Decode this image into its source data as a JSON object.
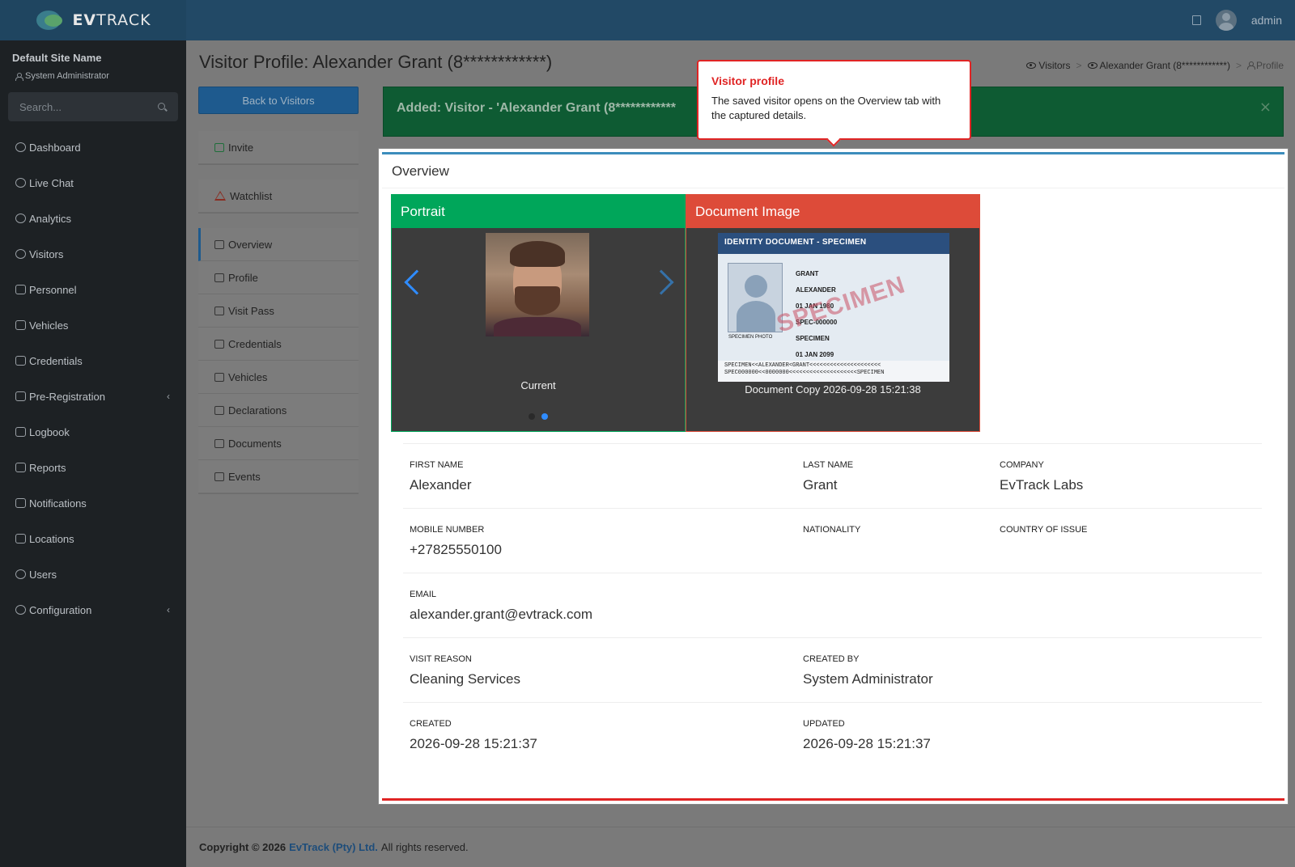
{
  "brand": {
    "logo_text_bold": "EV",
    "logo_text_rest": "TRACK"
  },
  "topbar": {
    "user": "admin"
  },
  "sidebar": {
    "site_name": "Default Site Name",
    "role": "System Administrator",
    "search_placeholder": "Search...",
    "items": [
      {
        "label": "Dashboard",
        "icon": "dashboard-icon"
      },
      {
        "label": "Live Chat",
        "icon": "headset-icon"
      },
      {
        "label": "Analytics",
        "icon": "target-icon"
      },
      {
        "label": "Visitors",
        "icon": "eye-icon"
      },
      {
        "label": "Personnel",
        "icon": "user-cog-icon"
      },
      {
        "label": "Vehicles",
        "icon": "car-icon"
      },
      {
        "label": "Credentials",
        "icon": "id-card-icon"
      },
      {
        "label": "Pre-Registration",
        "icon": "exchange-icon",
        "chevron": "‹"
      },
      {
        "label": "Logbook",
        "icon": "book-icon"
      },
      {
        "label": "Reports",
        "icon": "chart-icon"
      },
      {
        "label": "Notifications",
        "icon": "chat-icon"
      },
      {
        "label": "Locations",
        "icon": "building-icon"
      },
      {
        "label": "Users",
        "icon": "users-icon"
      },
      {
        "label": "Configuration",
        "icon": "gear-icon",
        "chevron": "‹"
      }
    ]
  },
  "page": {
    "title": "Visitor Profile: Alexander Grant (8************)",
    "breadcrumb": [
      "Visitors",
      "Alexander Grant (8************)",
      "Profile"
    ],
    "back_button": "Back to Visitors",
    "actions": [
      "Invite",
      "Watchlist"
    ],
    "tabs": [
      "Overview",
      "Profile",
      "Visit Pass",
      "Credentials",
      "Vehicles",
      "Declarations",
      "Documents",
      "Events"
    ],
    "active_tab": "Overview",
    "alert": "Added: Visitor - 'Alexander Grant (8************",
    "alert_close": "×"
  },
  "tooltip": {
    "title": "Visitor profile",
    "body": "The saved visitor opens on the Overview tab with the captured details."
  },
  "overview": {
    "heading": "Overview",
    "portrait": {
      "title": "Portrait",
      "caption": "Current"
    },
    "document": {
      "title": "Document Image",
      "caption": "Document Copy 2026-09-28 15:21:38",
      "card_header": "IDENTITY DOCUMENT - SPECIMEN",
      "watermark": "SPECIMEN",
      "photo_label": "SPECIMEN PHOTO",
      "fields": [
        "GRANT",
        "ALEXANDER",
        "01 JAN 1980",
        "SPEC-000000",
        "SPECIMEN",
        "01 JAN 2099"
      ],
      "mrz_1": "SPECIMEN<<ALEXANDER<GRANT<<<<<<<<<<<<<<<<<<<<<",
      "mrz_2": "SPEC000000<<0000000<<<<<<<<<<<<<<<<<<<<SPECIMEN"
    },
    "fields": {
      "first_name": {
        "label": "FIRST NAME",
        "value": "Alexander"
      },
      "last_name": {
        "label": "LAST NAME",
        "value": "Grant"
      },
      "company": {
        "label": "COMPANY",
        "value": "EvTrack Labs"
      },
      "mobile": {
        "label": "MOBILE NUMBER",
        "value": "+27825550100"
      },
      "nationality": {
        "label": "NATIONALITY",
        "value": ""
      },
      "country_issue": {
        "label": "COUNTRY OF ISSUE",
        "value": ""
      },
      "email": {
        "label": "EMAIL",
        "value": "alexander.grant@evtrack.com"
      },
      "visit_reason": {
        "label": "VISIT REASON",
        "value": "Cleaning Services"
      },
      "created_by": {
        "label": "CREATED BY",
        "value": "System Administrator"
      },
      "created": {
        "label": "CREATED",
        "value": "2026-09-28 15:21:37"
      },
      "updated": {
        "label": "UPDATED",
        "value": "2026-09-28 15:21:37"
      }
    }
  },
  "footer": {
    "prefix": "Copyright © 2026",
    "company": "EvTrack (Pty) Ltd.",
    "suffix": "All rights reserved."
  },
  "colors": {
    "accent": "#3c8dbc",
    "success": "#00a65a",
    "danger": "#dd4b39",
    "tooltip_red": "#e02424"
  }
}
